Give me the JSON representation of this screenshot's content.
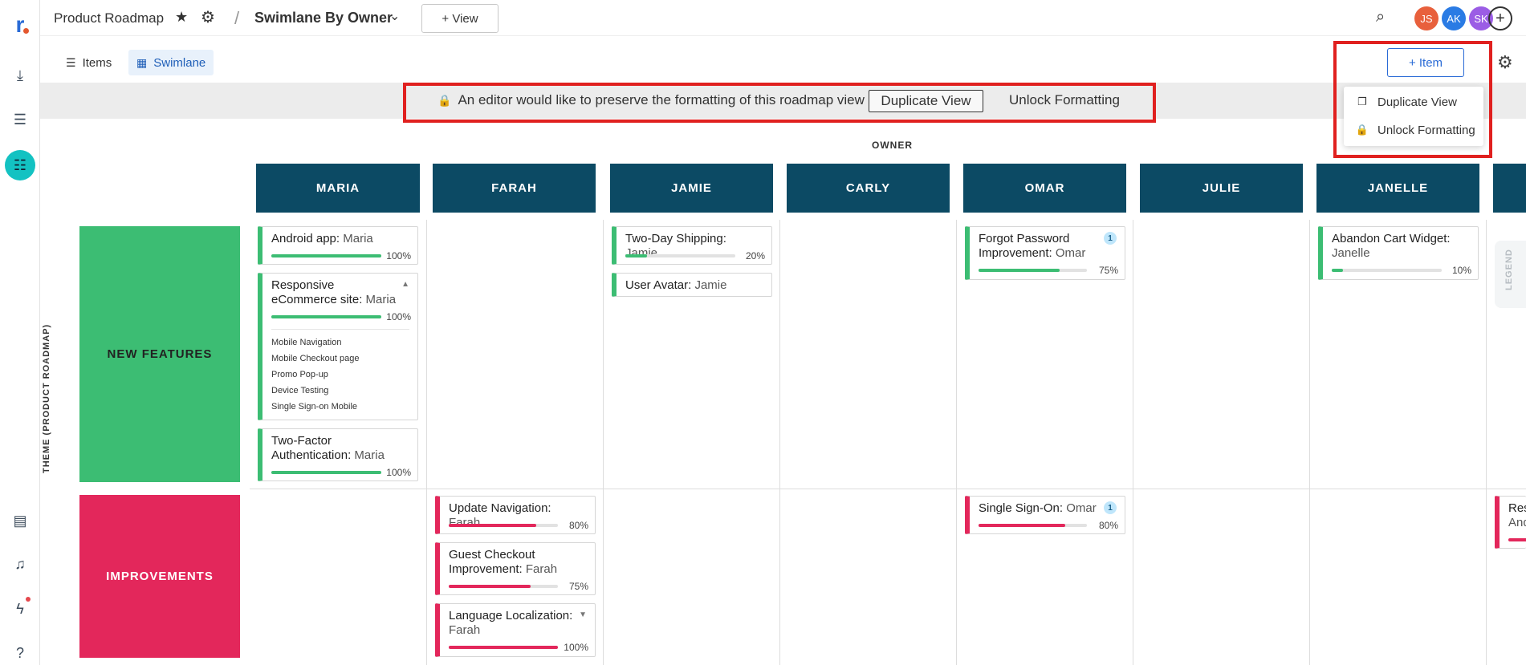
{
  "topbar": {
    "breadcrumb": "Product Roadmap",
    "separator": "/",
    "view_name": "Swimlane By Owner",
    "add_view": "+ View",
    "avatars": [
      {
        "initials": "JS",
        "color": "#e8603c"
      },
      {
        "initials": "AK",
        "color": "#2a7be4"
      },
      {
        "initials": "SK",
        "color": "#9b5de5"
      }
    ]
  },
  "toolbar": {
    "tabs": [
      {
        "label": "Items"
      },
      {
        "label": "Swimlane"
      }
    ],
    "add_item": "+ Item"
  },
  "menu": {
    "items": [
      {
        "label": "Duplicate View"
      },
      {
        "label": "Unlock Formatting"
      }
    ]
  },
  "banner": {
    "message": "An editor would like to preserve the formatting of this roadmap view",
    "duplicate_button": "Duplicate View",
    "unlock_link": "Unlock Formatting"
  },
  "board": {
    "owner_label": "OWNER",
    "theme_label": "THEME (PRODUCT ROADMAP)",
    "legend_label": "LEGEND",
    "columns": [
      "MARIA",
      "FARAH",
      "JAMIE",
      "CARLY",
      "OMAR",
      "JULIE",
      "JANELLE"
    ],
    "rows": [
      {
        "label": "NEW FEATURES",
        "color": "#3cbd73"
      },
      {
        "label": "IMPROVEMENTS",
        "color": "#e3275b"
      }
    ],
    "cards": [
      {
        "title": "Android app:",
        "owner": "Maria",
        "progress": 100,
        "pct": "100%"
      },
      {
        "title": "Responsive eCommerce site:",
        "owner": "Maria",
        "progress": 100,
        "pct": "100%",
        "subitems": [
          "Mobile Navigation",
          "Mobile Checkout page",
          "Promo Pop-up",
          "Device Testing",
          "Single Sign-on Mobile"
        ]
      },
      {
        "title": "Two-Factor Authentication:",
        "owner": "Maria",
        "progress": 100,
        "pct": "100%"
      },
      {
        "title": "Two-Day Shipping:",
        "owner": "Jamie",
        "progress": 20,
        "pct": "20%"
      },
      {
        "title": "User Avatar:",
        "owner": "Jamie"
      },
      {
        "title": "Forgot Password Improvement:",
        "owner": "Omar",
        "progress": 75,
        "pct": "75%",
        "badge": "1"
      },
      {
        "title": "Abandon Cart Widget:",
        "owner": "Janelle",
        "progress": 10,
        "pct": "10%"
      },
      {
        "title": "Update Navigation:",
        "owner": "Farah",
        "progress": 80,
        "pct": "80%"
      },
      {
        "title": "Guest Checkout Improvement:",
        "owner": "Farah",
        "progress": 75,
        "pct": "75%"
      },
      {
        "title": "Language Localization:",
        "owner": "Farah",
        "progress": 100,
        "pct": "100%"
      },
      {
        "title": "Single Sign-On:",
        "owner": "Omar",
        "progress": 80,
        "pct": "80%",
        "badge": "1"
      },
      {
        "title": "Res",
        "owner": "And"
      }
    ]
  },
  "icons": {
    "logo": "r",
    "star": "★",
    "gear": "⚙",
    "chevron": "⌄",
    "search": "⌕",
    "plus": "+",
    "lock": "🔒",
    "expand": "⤢"
  }
}
